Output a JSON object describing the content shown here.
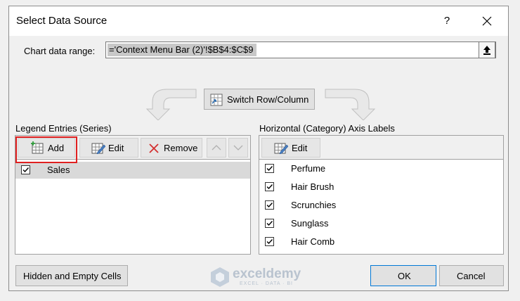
{
  "dialog": {
    "title": "Select Data Source",
    "help": "?",
    "chart_range_label": "Chart data range:",
    "chart_range_value": "='Context Menu Bar (2)'!$B$4:$C$9",
    "switch_label": "Switch Row/Column"
  },
  "legend": {
    "heading": "Legend Entries (Series)",
    "add_label": "Add",
    "edit_label": "Edit",
    "remove_label": "Remove",
    "items": [
      {
        "label": "Sales",
        "checked": true
      }
    ]
  },
  "axis": {
    "heading": "Horizontal (Category) Axis Labels",
    "edit_label": "Edit",
    "items": [
      {
        "label": "Perfume",
        "checked": true
      },
      {
        "label": "Hair Brush",
        "checked": true
      },
      {
        "label": "Scrunchies",
        "checked": true
      },
      {
        "label": "Sunglass",
        "checked": true
      },
      {
        "label": "Hair Comb",
        "checked": true
      }
    ]
  },
  "footer": {
    "hidden_cells_label": "Hidden and Empty Cells",
    "ok_label": "OK",
    "cancel_label": "Cancel"
  },
  "watermark": {
    "name": "exceldemy",
    "tagline": "EXCEL · DATA · BI"
  },
  "colors": {
    "highlight": "#e02020",
    "selected_row": "#d9d9d9"
  }
}
